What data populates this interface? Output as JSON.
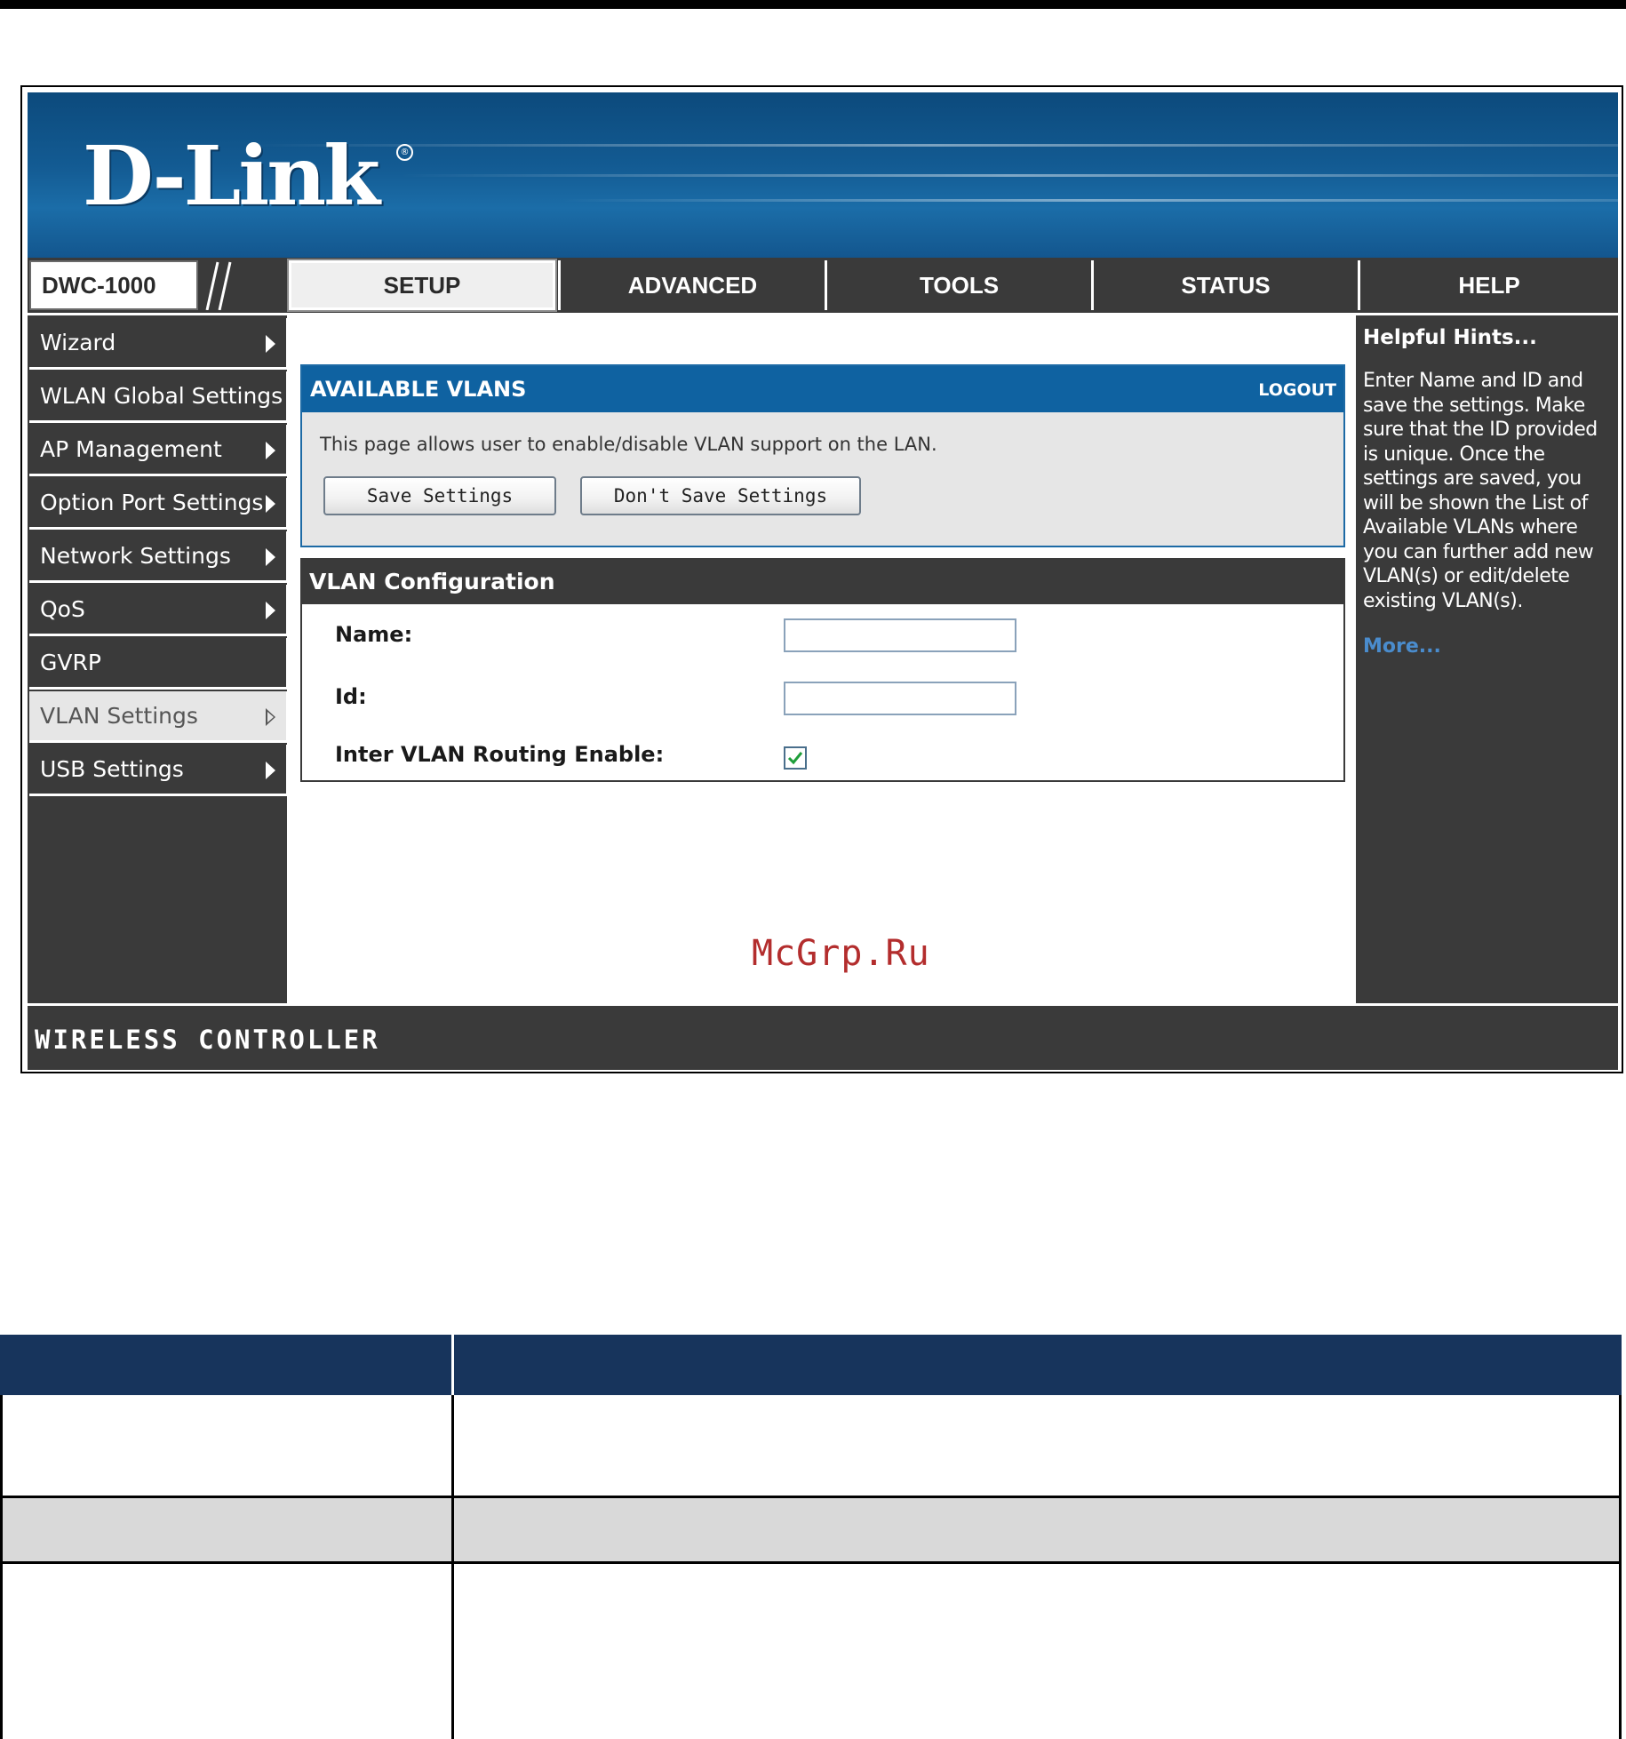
{
  "header": {
    "logo_text": "D-Link",
    "registered_mark": "®",
    "model": "DWC-1000"
  },
  "tabs": [
    {
      "label": "SETUP",
      "active": true
    },
    {
      "label": "ADVANCED",
      "active": false
    },
    {
      "label": "TOOLS",
      "active": false
    },
    {
      "label": "STATUS",
      "active": false
    },
    {
      "label": "HELP",
      "active": false
    }
  ],
  "sidebar": {
    "items": [
      {
        "label": "Wizard",
        "arrow": true
      },
      {
        "label": "WLAN Global Settings",
        "arrow": false
      },
      {
        "label": "AP Management",
        "arrow": true
      },
      {
        "label": "Option Port Settings",
        "arrow": true
      },
      {
        "label": "Network Settings",
        "arrow": true
      },
      {
        "label": "QoS",
        "arrow": true
      },
      {
        "label": "GVRP",
        "arrow": false
      },
      {
        "label": "VLAN Settings",
        "arrow": true,
        "active": true
      },
      {
        "label": "USB Settings",
        "arrow": true
      }
    ]
  },
  "available_vlans": {
    "title": "AVAILABLE VLANS",
    "logout": "LOGOUT",
    "description": "This page allows user to enable/disable VLAN support on the LAN.",
    "save_button": "Save Settings",
    "dont_save_button": "Don't Save Settings"
  },
  "vlan_config": {
    "title": "VLAN Configuration",
    "name_label": "Name:",
    "name_value": "",
    "id_label": "Id:",
    "id_value": "",
    "routing_label": "Inter VLAN Routing Enable:",
    "routing_checked": true
  },
  "watermark": "McGrp.Ru",
  "help": {
    "title": "Helpful Hints...",
    "text": "Enter Name and ID and save the settings. Make sure that the ID provided is unique. Once the settings are saved, you will be shown the List of Available VLANs where you can further add new VLAN(s) or edit/delete existing VLAN(s).",
    "more": "More..."
  },
  "footer": {
    "text": "WIRELESS CONTROLLER"
  },
  "colors": {
    "banner_blue": "#135b93",
    "panel_blue": "#0f62a1",
    "dark_gray": "#3a3a3a",
    "table_header": "#17345c",
    "watermark_red": "#b32d2d"
  }
}
